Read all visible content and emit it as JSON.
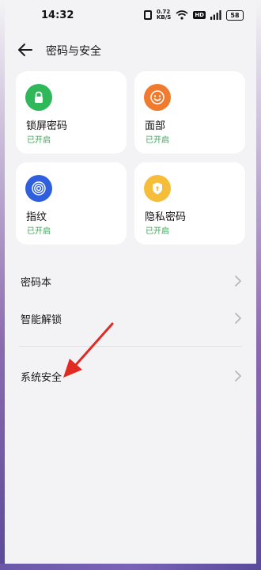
{
  "status_bar": {
    "time": "14:32",
    "speed_value": "0.72",
    "speed_unit": "KB/S",
    "hd_label": "HD",
    "battery": "58"
  },
  "header": {
    "title": "密码与安全"
  },
  "cards": [
    {
      "title": "锁屏密码",
      "status": "已开启",
      "icon": "lock-icon",
      "color": "#2fb85a"
    },
    {
      "title": "面部",
      "status": "已开启",
      "icon": "face-icon",
      "color": "#f07a2d"
    },
    {
      "title": "指纹",
      "status": "已开启",
      "icon": "fingerprint-icon",
      "color": "#2f5fdd"
    },
    {
      "title": "隐私密码",
      "status": "已开启",
      "icon": "shield-icon",
      "color": "#f5bd3a"
    }
  ],
  "list": [
    {
      "label": "密码本"
    },
    {
      "label": "智能解锁"
    },
    {
      "label": "系统安全"
    }
  ],
  "colors": {
    "status_green": "#3aa757",
    "annotation_red": "#e02a22"
  }
}
